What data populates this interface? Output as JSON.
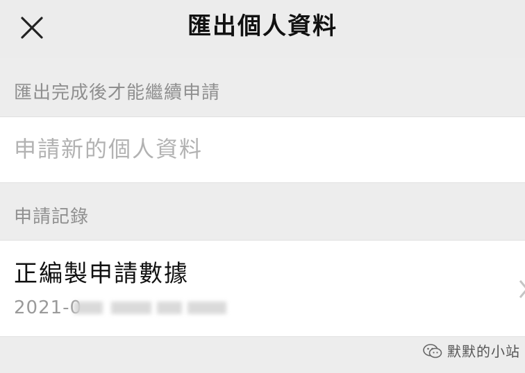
{
  "header": {
    "title": "匯出個人資料",
    "close_icon": "close-icon"
  },
  "notice": {
    "text": "匯出完成後才能繼續申請"
  },
  "new_request": {
    "label": "申請新的個人資料"
  },
  "records_section": {
    "label": "申請記錄"
  },
  "records": [
    {
      "title": "正編製申請數據",
      "date_visible": "2021-0"
    }
  ],
  "watermark": {
    "text": "默默的小站",
    "icon": "wechat-icon"
  },
  "colors": {
    "background": "#ececec",
    "card": "#ffffff",
    "title_text": "#111111",
    "secondary_text": "#8f8f8f",
    "disabled_text": "#b2b2b2"
  }
}
